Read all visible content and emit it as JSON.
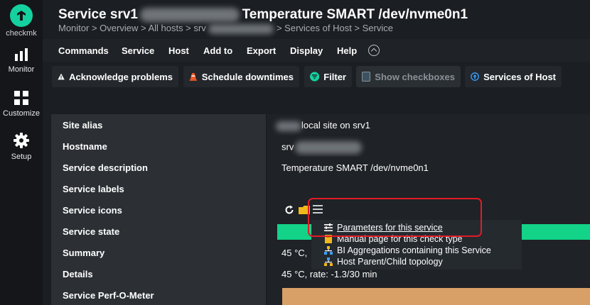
{
  "sidebar": {
    "logo_text": "checkmk",
    "items": [
      {
        "label": "Monitor",
        "icon": "bar-chart-icon"
      },
      {
        "label": "Customize",
        "icon": "grid-icon"
      },
      {
        "label": "Setup",
        "icon": "gear-icon"
      }
    ]
  },
  "header": {
    "title_prefix": "Service srv1",
    "title_suffix": "Temperature SMART /dev/nvme0n1",
    "breadcrumb_prefix": "Monitor > Overview > All hosts > srv",
    "breadcrumb_suffix": "> Services of Host > Service"
  },
  "menubar": [
    "Commands",
    "Service",
    "Host",
    "Add to",
    "Export",
    "Display",
    "Help"
  ],
  "actions": {
    "acknowledge": "Acknowledge problems",
    "downtimes": "Schedule downtimes",
    "filter": "Filter",
    "checkboxes": "Show checkboxes",
    "services_of_host": "Services of Host"
  },
  "table": {
    "rows": [
      {
        "label": "Site alias",
        "value": "local site on srv1"
      },
      {
        "label": "Hostname",
        "value": "srv"
      },
      {
        "label": "Service description",
        "value": "Temperature SMART /dev/nvme0n1"
      },
      {
        "label": "Service labels",
        "value": ""
      },
      {
        "label": "Service icons",
        "value": ""
      },
      {
        "label": "Service state",
        "value": ""
      },
      {
        "label": "Summary",
        "value": "45 °C,"
      },
      {
        "label": "Details",
        "value": "45 °C, rate: -1.3/30 min"
      },
      {
        "label": "Service Perf-O-Meter",
        "value": ""
      }
    ]
  },
  "popup": [
    "Parameters for this service",
    "Manual page for this check type",
    "BI Aggregations containing this Service",
    "Host Parent/Child topology"
  ],
  "colors": {
    "accent": "#15d1a0",
    "state_ok": "#13d389",
    "perf": "#d8a067",
    "highlight": "#e21b26"
  }
}
